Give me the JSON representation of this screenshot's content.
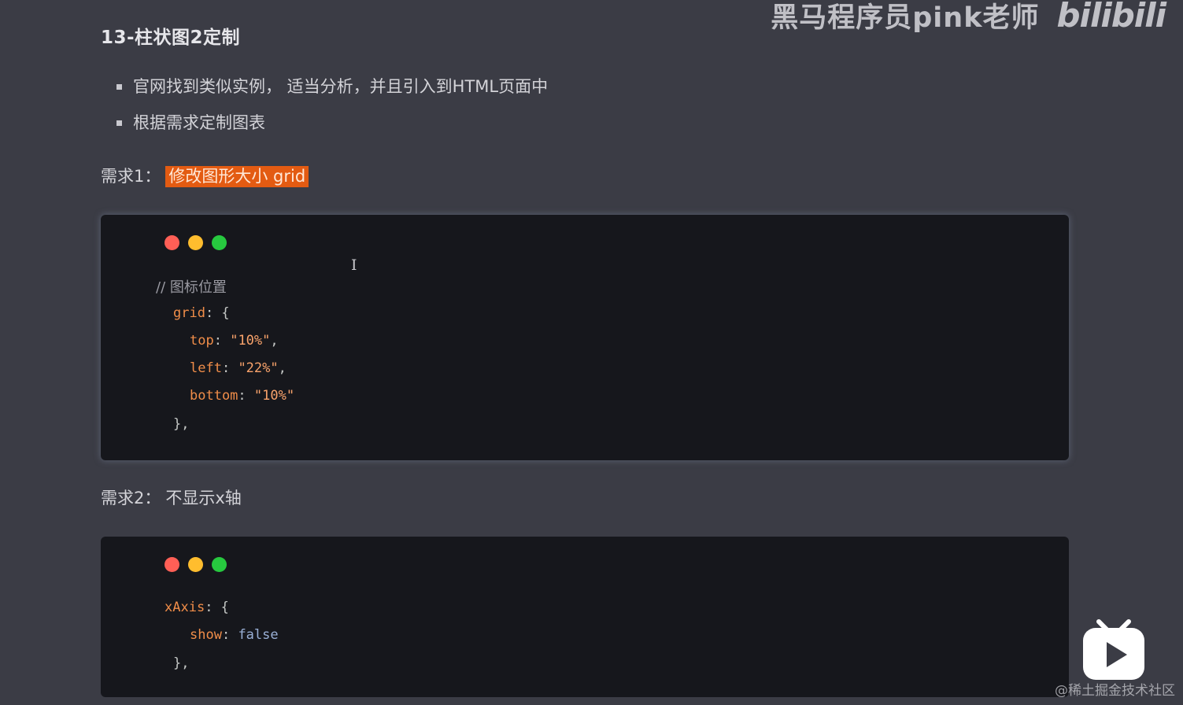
{
  "watermark": {
    "channel": "黑马程序员pink老师",
    "logo": "bilibili"
  },
  "section_title": "13-柱状图2定制",
  "bullets": [
    "官网找到类似实例， 适当分析，并且引入到HTML页面中",
    "根据需求定制图表"
  ],
  "requirement1": {
    "label": "需求1：",
    "value": "修改图形大小 grid"
  },
  "requirement2": {
    "label": "需求2：",
    "value": "不显示x轴"
  },
  "code1": {
    "comment": "// 图标位置",
    "grid_key": "grid",
    "open": ": {",
    "top_key": "top",
    "top_val": "\"10%\"",
    "left_key": "left",
    "left_val": "\"22%\"",
    "bottom_key": "bottom",
    "bottom_val": "\"10%\"",
    "close": "},"
  },
  "code2": {
    "xaxis_key": "xAxis",
    "open": ": {",
    "show_key": "show",
    "show_val": "false",
    "close": "},"
  },
  "punct": {
    "colon": ": ",
    "comma": ","
  },
  "cursor_glyph": "I",
  "footer_credit": "@稀土掘金技术社区",
  "colors": {
    "background": "#3b3c45",
    "code_background": "#16171c",
    "highlight": "#e35b12",
    "code_key": "#f08d49",
    "code_bool": "#9ab0d6"
  }
}
